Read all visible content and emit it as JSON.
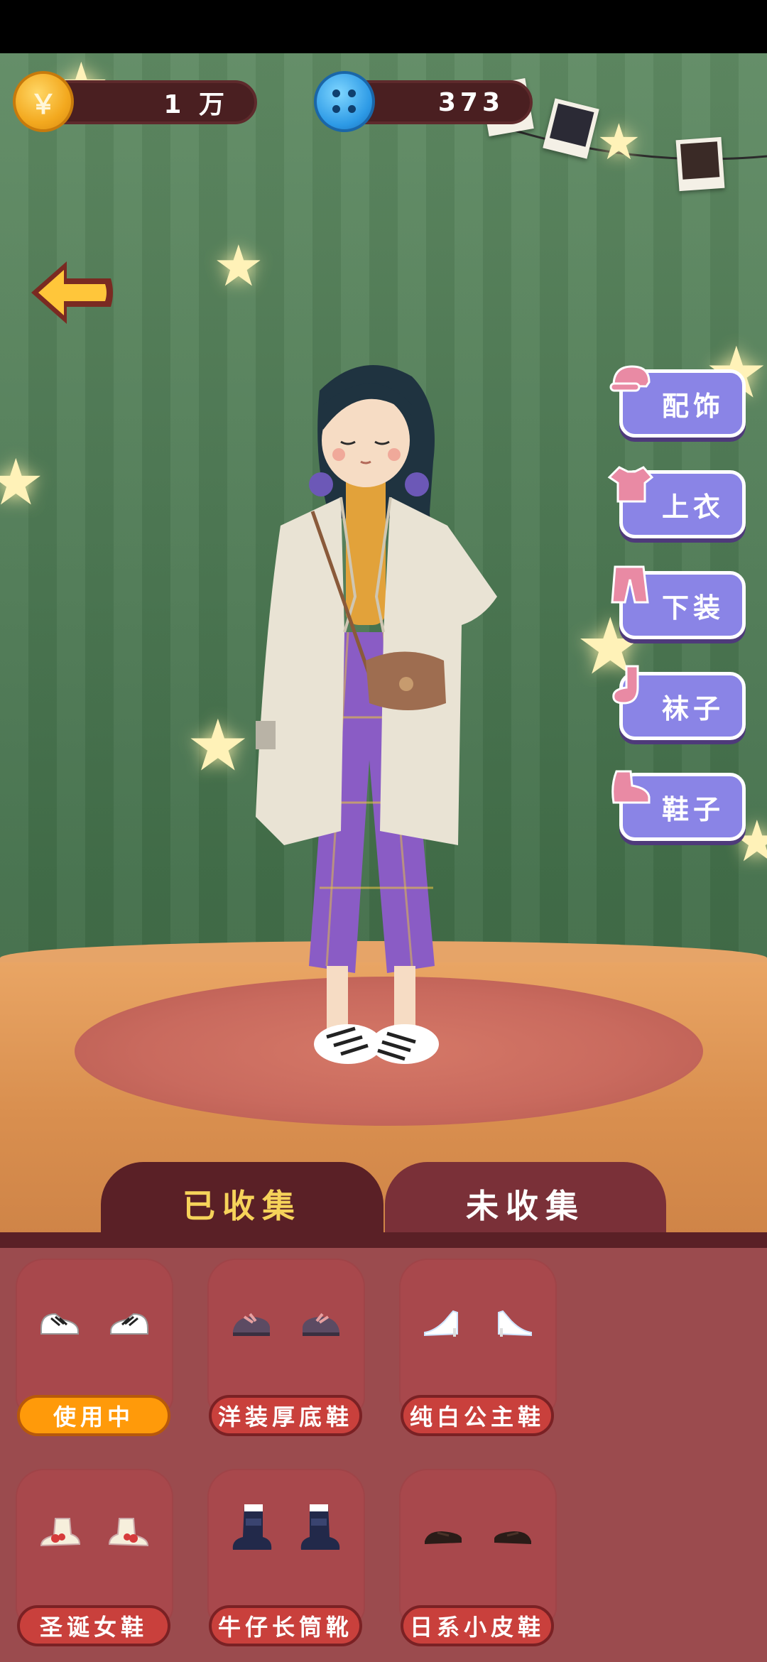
{
  "currencies": {
    "coins": {
      "icon": "coin-icon",
      "glyph": "￥",
      "amount": "1 万"
    },
    "buttons": {
      "icon": "blue-button-icon",
      "amount": "373"
    }
  },
  "categories": [
    {
      "label": "配饰",
      "icon": "hat-icon"
    },
    {
      "label": "上衣",
      "icon": "shirt-icon"
    },
    {
      "label": "下装",
      "icon": "pants-icon"
    },
    {
      "label": "袜子",
      "icon": "sock-icon"
    },
    {
      "label": "鞋子",
      "icon": "shoe-icon"
    }
  ],
  "tabs": {
    "collected": "已收集",
    "uncollected": "未收集"
  },
  "items": [
    {
      "label": "使用中",
      "in_use": true,
      "color": "#ffffff",
      "accent": "#222222"
    },
    {
      "label": "洋装厚底鞋",
      "in_use": false,
      "color": "#5c4b63",
      "accent": "#e7a0a0"
    },
    {
      "label": "纯白公主鞋",
      "in_use": false,
      "color": "#ffffff",
      "accent": "#cfe4ff"
    },
    {
      "label": "圣诞女鞋",
      "in_use": false,
      "color": "#f6efdc",
      "accent": "#d63b3b"
    },
    {
      "label": "牛仔长筒靴",
      "in_use": false,
      "color": "#22294a",
      "accent": "#ffffff"
    },
    {
      "label": "日系小皮鞋",
      "in_use": false,
      "color": "#2a1c18",
      "accent": "#4a3228"
    }
  ],
  "colors": {
    "curtain": "#4f7b55",
    "panel": "#9b4b4e",
    "tab_active": "#5a2026",
    "tab_active_text": "#f6d35a",
    "category_button": "#8a84e6",
    "item_pill": "#c9403c",
    "in_use_pill": "#ff9a0a"
  }
}
